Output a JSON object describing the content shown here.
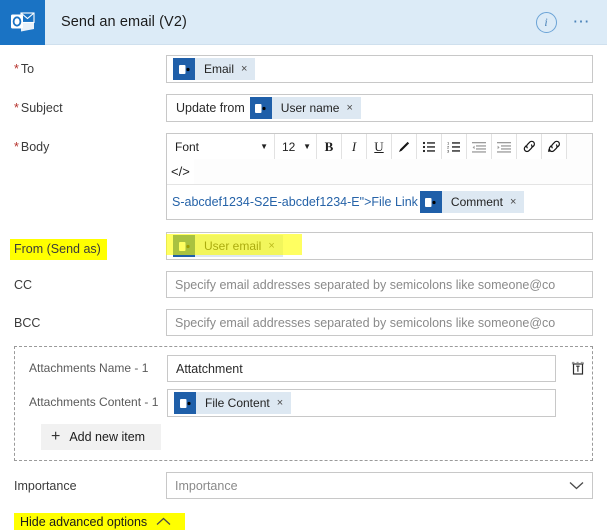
{
  "header": {
    "app_icon": "outlook-icon",
    "title": "Send an email (V2)",
    "info_icon": "info-icon",
    "more_icon": "ellipsis-icon"
  },
  "fields": {
    "to": {
      "label": "To",
      "required": true,
      "token": {
        "label": "Email",
        "remove": "×"
      }
    },
    "subject": {
      "label": "Subject",
      "required": true,
      "prefix_text": "Update from",
      "token": {
        "label": "User name",
        "remove": "×"
      }
    },
    "body": {
      "label": "Body",
      "required": true,
      "toolbar": {
        "font_label": "Font",
        "size_label": "12",
        "bold": "B",
        "italic": "I",
        "underline": "U",
        "highlighter": "pen-icon",
        "bullet_list": "bullet-list-icon",
        "numbered_list": "numbered-list-icon",
        "outdent": "outdent-icon",
        "indent": "indent-icon",
        "link": "link-icon",
        "unlink": "unlink-icon",
        "code_view": "</>"
      },
      "content_link": "S-abcdef1234-S2E-abcdef1234-E\">File Link",
      "token": {
        "label": "Comment",
        "remove": "×"
      }
    },
    "from": {
      "label": "From (Send as)",
      "highlighted": true,
      "token": {
        "label": "User email",
        "remove": "×"
      }
    },
    "cc": {
      "label": "CC",
      "placeholder": "Specify email addresses separated by semicolons like someone@co"
    },
    "bcc": {
      "label": "BCC",
      "placeholder": "Specify email addresses separated by semicolons like someone@co"
    },
    "importance": {
      "label": "Importance",
      "placeholder": "Importance",
      "chevron": "chevron-down-icon"
    }
  },
  "attachments": {
    "name_label": "Attachments Name - 1",
    "name_value": "Attatchment",
    "content_label": "Attachments Content - 1",
    "content_token": {
      "label": "File Content",
      "remove": "×"
    },
    "delete_icon": "trash-icon",
    "add_label": "Add new item",
    "add_plus": "+"
  },
  "footer": {
    "hide_advanced_label": "Hide advanced options",
    "chevron": "chevron-up-icon"
  },
  "colors": {
    "header_bg": "#dcebf7",
    "app_icon_bg": "#1a73c4",
    "token_bg": "#dde8f2",
    "token_icon_bg": "#1f5fa9",
    "link_text": "#2663a8",
    "required_asterisk": "#b5302a",
    "highlight": "#ffff00"
  }
}
